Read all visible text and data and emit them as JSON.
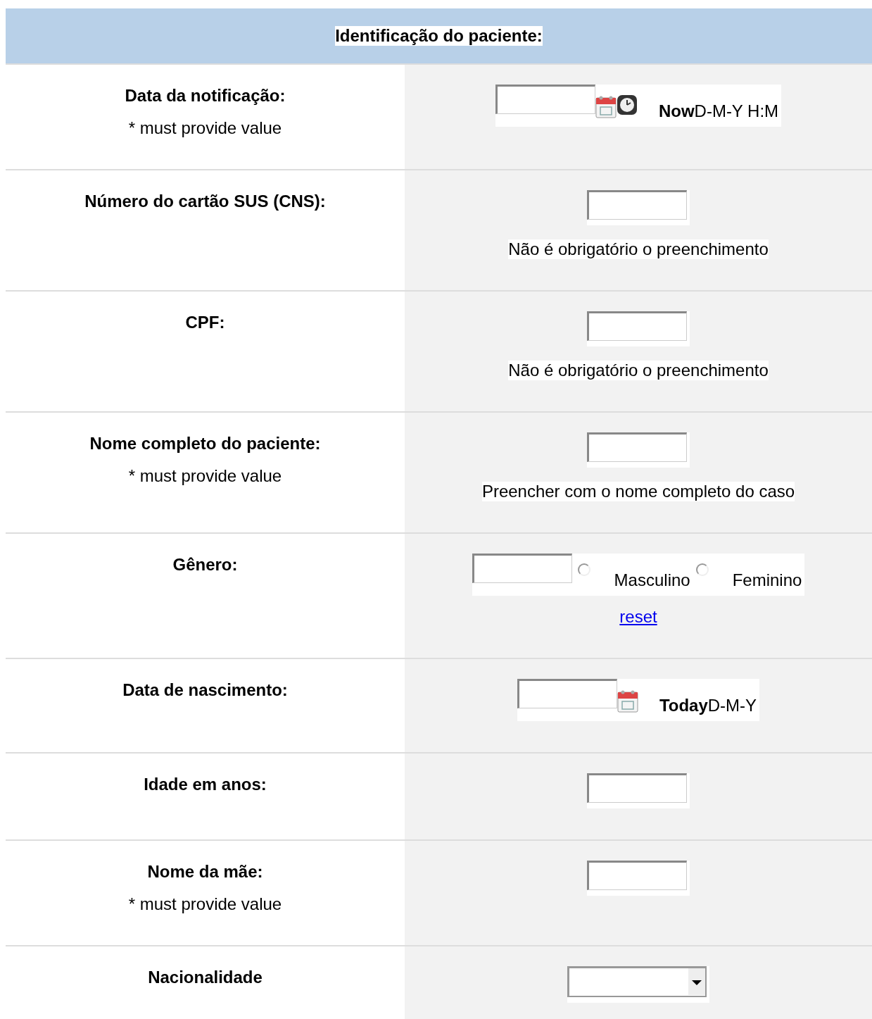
{
  "section_title": "Identificação do paciente:",
  "fields": [
    {
      "label": "Data da notificação:",
      "required_note": "* must provide value",
      "kind": "datetime",
      "now_button": "Now",
      "format": "D-M-Y H:M"
    },
    {
      "label": "Número do cartão SUS (CNS):",
      "kind": "text",
      "hint": "Não é obrigatório o preenchimento"
    },
    {
      "label": "CPF:",
      "kind": "text",
      "hint": "Não é obrigatório o preenchimento"
    },
    {
      "label": "Nome completo do paciente:",
      "required_note": "* must provide value",
      "kind": "text",
      "hint": "Preencher com o nome completo do caso"
    },
    {
      "label": "Gênero:",
      "kind": "radio",
      "options": [
        {
          "label": "Masculino",
          "selected": false
        },
        {
          "label": "Feminino",
          "selected": false
        }
      ],
      "reset_link": "reset"
    },
    {
      "label": "Data de nascimento:",
      "kind": "date",
      "now_button": "Today",
      "format": "D-M-Y"
    },
    {
      "label": "Idade em anos:",
      "kind": "text"
    },
    {
      "label": "Nome da mãe:",
      "required_note": "* must provide value",
      "kind": "text"
    },
    {
      "label": "Nacionalidade",
      "kind": "select"
    }
  ]
}
